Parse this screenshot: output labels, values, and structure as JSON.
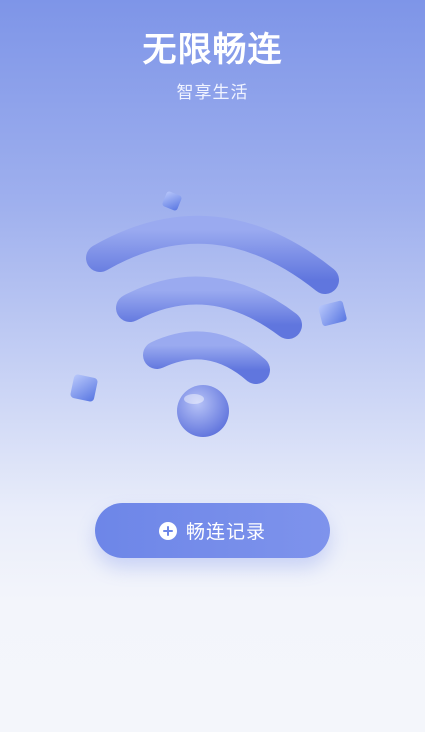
{
  "header": {
    "title": "无限畅连",
    "subtitle": "智享生活"
  },
  "illustration": {
    "icon": "wifi-icon"
  },
  "action": {
    "label": "畅连记录",
    "icon": "plus-circle-icon"
  },
  "colors": {
    "accent": "#6d86e8",
    "background_top": "#7e95e8",
    "background_bottom": "#f4f6fb"
  }
}
